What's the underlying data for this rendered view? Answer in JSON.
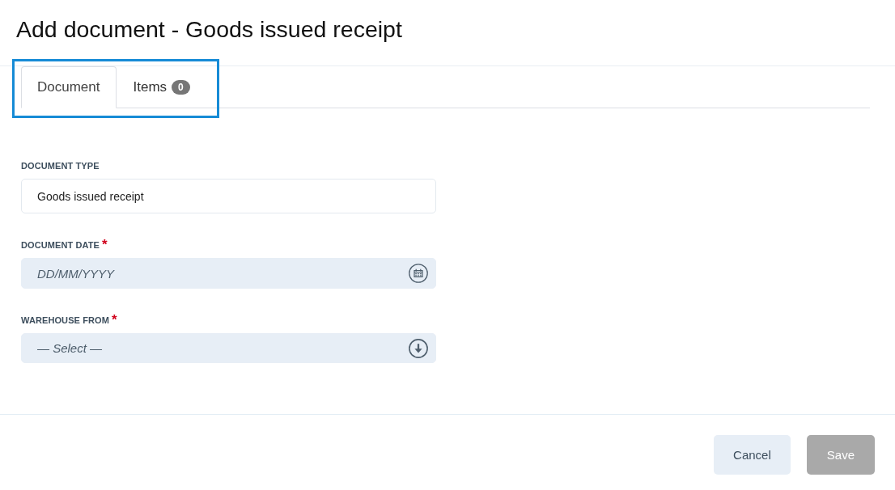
{
  "title": "Add document - Goods issued receipt",
  "tab_bar": {
    "highlighted": true,
    "tabs": [
      {
        "label": "Document",
        "selected": true
      },
      {
        "label": "Items",
        "badge": "0",
        "selected": false
      }
    ]
  },
  "fields": [
    {
      "kind": "text",
      "label": "DOCUMENT TYPE",
      "value": "Goods issued receipt"
    },
    {
      "kind": "date",
      "label": "DOCUMENT DATE",
      "required_mark": "*",
      "placeholder": "DD/MM/YYYY"
    },
    {
      "kind": "select",
      "label": "WAREHOUSE FROM",
      "required_mark": "*",
      "placeholder": "— Select —"
    }
  ],
  "buttons": [
    {
      "kind": "cancel",
      "label": "Cancel",
      "disabled": false
    },
    {
      "kind": "save",
      "label": "Save",
      "disabled": true
    }
  ]
}
